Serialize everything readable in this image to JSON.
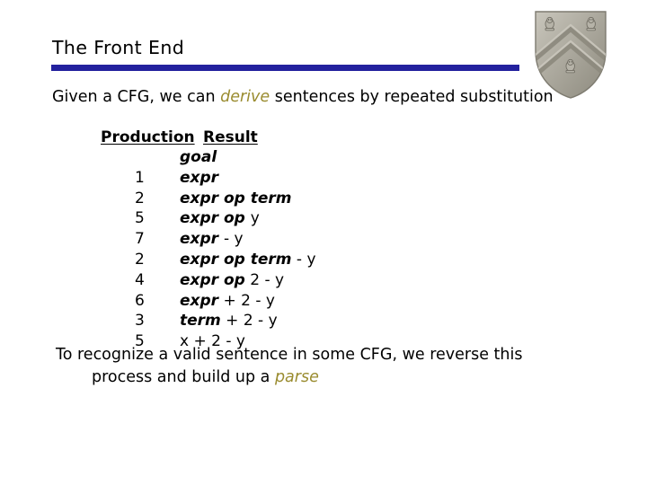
{
  "slide": {
    "title": "The Front End",
    "accent_color": "#23219e",
    "highlight_color": "#9a8c30",
    "background_color": "#ffffff",
    "text_color": "#000000"
  },
  "intro": {
    "before": "Given a CFG, we can ",
    "highlight": "derive",
    "after": " sentences by repeated substitution"
  },
  "table": {
    "headers": {
      "production": "Production",
      "result": "Result"
    },
    "rows": [
      {
        "production": "",
        "result_parts": [
          {
            "text": "goal",
            "kind": "nonterminal"
          }
        ]
      },
      {
        "production": "1",
        "result_parts": [
          {
            "text": "expr",
            "kind": "nonterminal"
          }
        ]
      },
      {
        "production": "2",
        "result_parts": [
          {
            "text": "expr op term",
            "kind": "nonterminal"
          }
        ]
      },
      {
        "production": "5",
        "result_parts": [
          {
            "text": "expr op ",
            "kind": "nonterminal"
          },
          {
            "text": "y",
            "kind": "terminal"
          }
        ]
      },
      {
        "production": "7",
        "result_parts": [
          {
            "text": "expr ",
            "kind": "nonterminal"
          },
          {
            "text": "- y",
            "kind": "terminal"
          }
        ]
      },
      {
        "production": "2",
        "result_parts": [
          {
            "text": "expr op term",
            "kind": "nonterminal"
          },
          {
            "text": " - y",
            "kind": "terminal"
          }
        ]
      },
      {
        "production": "4",
        "result_parts": [
          {
            "text": "expr op",
            "kind": "nonterminal"
          },
          {
            "text": " 2 - y",
            "kind": "terminal"
          }
        ]
      },
      {
        "production": "6",
        "result_parts": [
          {
            "text": "expr",
            "kind": "nonterminal"
          },
          {
            "text": " + 2 - y",
            "kind": "terminal"
          }
        ]
      },
      {
        "production": "3",
        "result_parts": [
          {
            "text": "term",
            "kind": "nonterminal"
          },
          {
            "text": " + 2 - y",
            "kind": "terminal"
          }
        ]
      },
      {
        "production": "5",
        "result_parts": [
          {
            "text": "x + 2 - y",
            "kind": "terminal"
          }
        ]
      }
    ]
  },
  "closing": {
    "line1": "To recognize a valid sentence in some CFG, we reverse this",
    "line2_before": "process and build up a ",
    "line2_highlight": "parse"
  },
  "crest": {
    "icon": "rice-university-shield-crest",
    "shield_color": "#a9a599",
    "shield_shadow": "#8b8679"
  }
}
